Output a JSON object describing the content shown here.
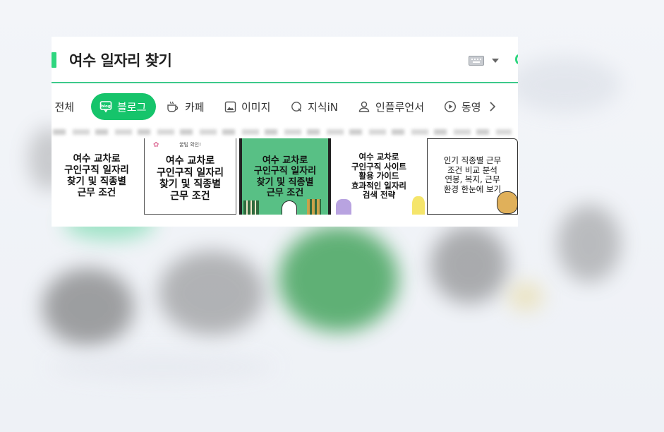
{
  "search": {
    "query": "여수 일자리 찾기"
  },
  "tabs": [
    {
      "label": "전체",
      "icon": "partial-icon",
      "active": false
    },
    {
      "label": "블로그",
      "icon": "blog-icon",
      "active": true
    },
    {
      "label": "카페",
      "icon": "cafe-cup-icon",
      "active": false
    },
    {
      "label": "이미지",
      "icon": "image-icon",
      "active": false
    },
    {
      "label": "지식iN",
      "icon": "q-icon",
      "active": false
    },
    {
      "label": "인플루언서",
      "icon": "person-icon",
      "active": false
    },
    {
      "label": "동영",
      "icon": "play-icon",
      "active": false
    }
  ],
  "thumbnails": [
    {
      "text": "여수 교차로\n구인구직 일자리\n찾기 및 직종별\n근무 조건"
    },
    {
      "badge": "꿀팁 확인!",
      "text": "여수 교차로\n구인구직 일자리\n찾기 및 직종별\n근무 조건"
    },
    {
      "text": "여수 교차로\n구인구직 일자리\n찾기 및 직종별\n근무 조건"
    },
    {
      "text": "여수 교차로\n구인구직 사이트\n활용 가이드\n효과적인 일자리\n검색 전략"
    },
    {
      "text": "인기 직종별 근무\n조건 비교 분석\n연봉, 복지, 근무\n환경 한눈에 보기"
    }
  ],
  "colors": {
    "accent": "#16c46b",
    "underline": "#3cc98b",
    "thumb_green": "#58c085"
  }
}
